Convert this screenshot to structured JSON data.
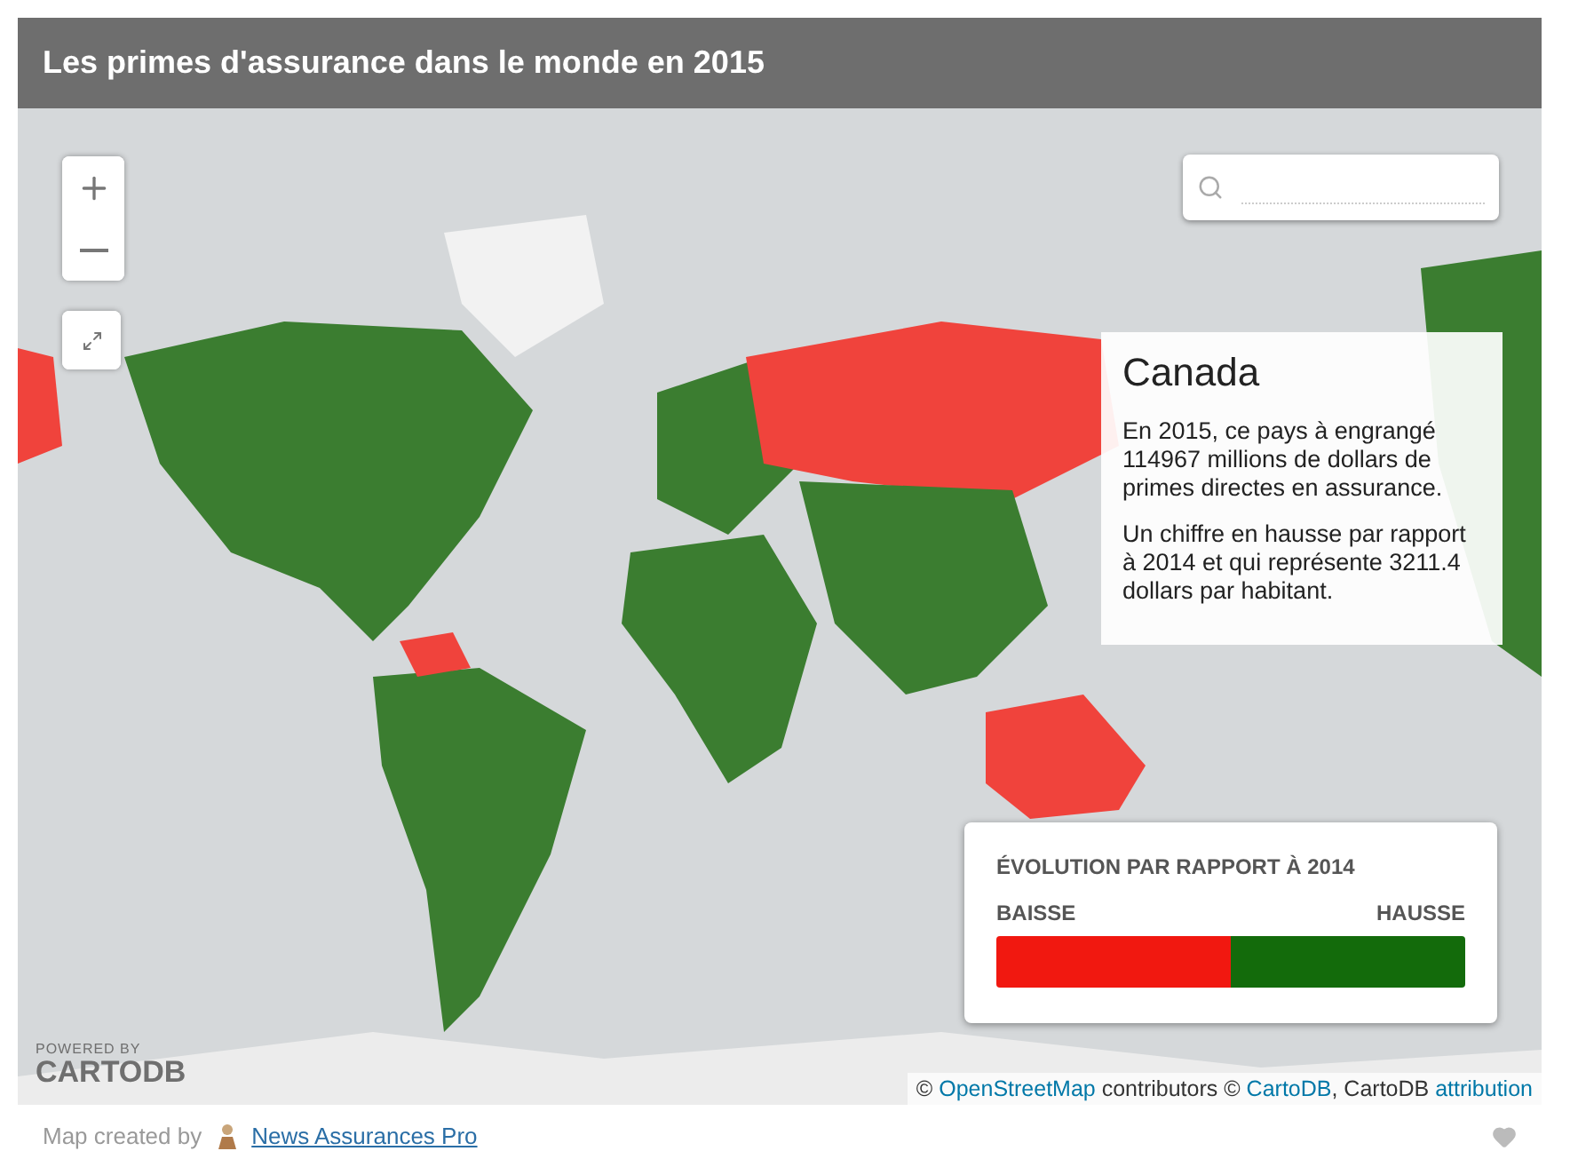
{
  "header": {
    "title": "Les primes d'assurance dans le monde en 2015"
  },
  "infowindow": {
    "title": "Canada",
    "paragraphs": [
      "En 2015, ce pays à engrangé 114967 millions de dollars de primes directes en assurance.",
      "Un chiffre en hausse par rapport à 2014 et qui représente 3211.4 dollars par habitant."
    ]
  },
  "legend": {
    "title": "ÉVOLUTION PAR RAPPORT À 2014",
    "items": [
      {
        "label": "BAISSE",
        "color": "#f11810"
      },
      {
        "label": "HAUSSE",
        "color": "#136b0b"
      }
    ]
  },
  "logo": {
    "top": "POWERED BY",
    "bottom": "CARTODB"
  },
  "attribution": [
    {
      "text": "© ",
      "link": false
    },
    {
      "text": "OpenStreetMap",
      "link": true
    },
    {
      "text": " contributors © ",
      "link": false
    },
    {
      "text": "CartoDB",
      "link": true
    },
    {
      "text": ", CartoDB ",
      "link": false
    },
    {
      "text": "attribution",
      "link": true
    }
  ],
  "footer": {
    "prefix": "Map created by",
    "author": "News Assurances Pro"
  }
}
